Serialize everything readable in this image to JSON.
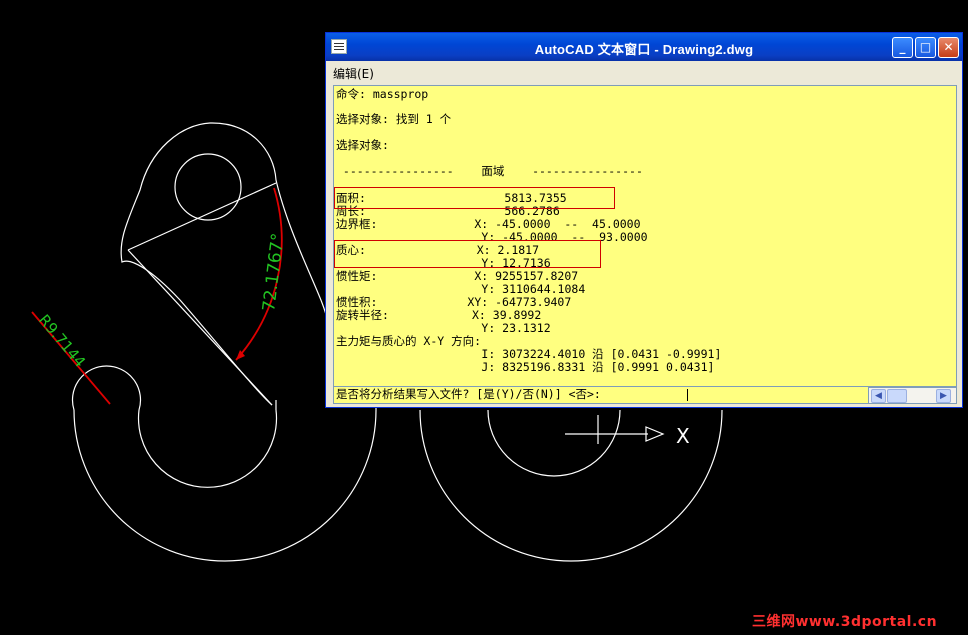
{
  "window": {
    "title": "AutoCAD 文本窗口 - Drawing2.dwg",
    "buttons": {
      "minimize": "_",
      "maximize": "□",
      "close": "✕"
    },
    "menu": {
      "edit": "编辑(E)"
    }
  },
  "output_lines": [
    "命令: massprop",
    "选择对象: 找到 1 个",
    "选择对象:",
    " ----------------    面域    ----------------",
    "面积:                    5813.7355",
    "周长:                    566.2786",
    "边界框:              X: -45.0000  --  45.0000",
    "                     Y: -45.0000  --  93.0000",
    "质心:                X: 2.1817",
    "                     Y: 12.7136",
    "惯性矩:              X: 9255157.8207",
    "                     Y: 3110644.1084",
    "惯性积:             XY: -64773.9407",
    "旋转半径:            X: 39.8992",
    "                     Y: 23.1312",
    "主力矩与质心的 X-Y 方向:",
    "                     I: 3073224.4010 沿 [0.0431 -0.9991]",
    "                     J: 8325196.8331 沿 [0.9991 0.0431]"
  ],
  "command_prompt": "是否将分析结果写入文件? [是(Y)/否(N)] <否>:",
  "scrollbar": {
    "left": "◀",
    "right": "▶"
  },
  "drawing": {
    "dim_radius": "R9.7144",
    "dim_angle": "72.1767°",
    "axis_label": "X",
    "colors": {
      "geometry": "#ffffff",
      "dim_green": "#22c322",
      "dim_red": "#dd0000",
      "text_bg": "#ffff80"
    }
  },
  "watermark": "三维网www.3dportal.cn"
}
